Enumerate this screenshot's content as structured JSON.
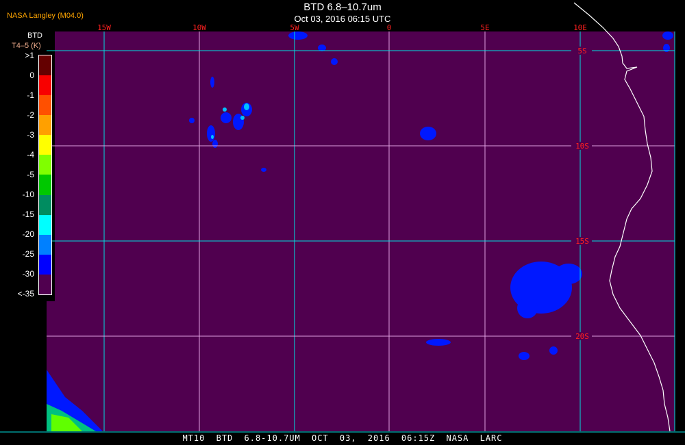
{
  "header": {
    "title": "BTD 6.8–10.7um",
    "subtitle": "Oct 03, 2016 06:15 UTC",
    "org": "NASA Langley (M04.0)"
  },
  "colorbar": {
    "title": "BTD",
    "unit": "T4–5 (K)",
    "labels": [
      ">1",
      "0",
      "-1",
      "-2",
      "-3",
      "-4",
      "-5",
      "-10",
      "-15",
      "-20",
      "-25",
      "-30",
      "<-35"
    ],
    "colors": [
      "#640000",
      "#f80000",
      "#ff5000",
      "#ffa000",
      "#ffff00",
      "#80ff00",
      "#00c800",
      "#008c60",
      "#00ffff",
      "#0080ff",
      "#0000ff",
      "#50004f"
    ]
  },
  "map": {
    "background": "#50004f",
    "cyan_grid": "#00e0e0",
    "light_grid": "#e0a0e0",
    "lon_labels": [
      "15W",
      "10W",
      "5W",
      "0",
      "5E",
      "10E"
    ],
    "lat_labels": [
      "5S",
      "10S",
      "15S",
      "20S"
    ],
    "label_color": "#ff2020",
    "coast_color": "#ffffff"
  },
  "footer": {
    "text": "MT10  BTD 6.8-10.7UM   OCT 03, 2016 06:15Z   NASA LARC"
  }
}
